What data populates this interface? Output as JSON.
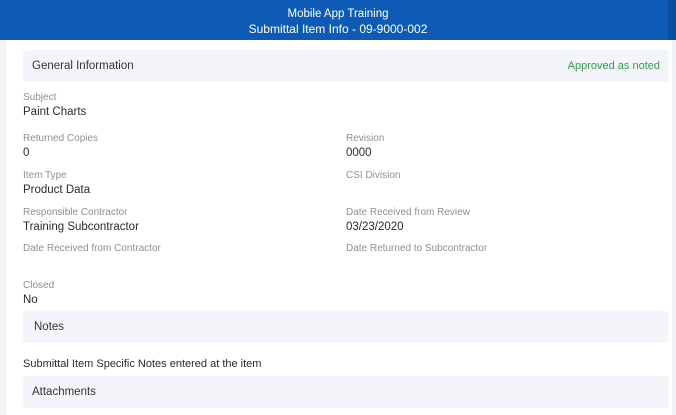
{
  "header": {
    "app_name": "Mobile App Training",
    "screen_title": "Submittal Item Info - 09-9000-002"
  },
  "general": {
    "title": "General Information",
    "status": "Approved as noted",
    "status_color": "#2e9d46"
  },
  "fields": {
    "subject": {
      "label": "Subject",
      "value": "Paint Charts"
    },
    "returned_copies": {
      "label": "Returned Copies",
      "value": "0"
    },
    "revision": {
      "label": "Revision",
      "value": "0000"
    },
    "item_type": {
      "label": "Item Type",
      "value": "Product Data"
    },
    "csi_division": {
      "label": "CSI Division",
      "value": ""
    },
    "responsible_contractor": {
      "label": "Responsible Contractor",
      "value": "Training Subcontractor"
    },
    "date_received_review": {
      "label": "Date Received from Review",
      "value": "03/23/2020"
    },
    "date_received_contractor": {
      "label": "Date Received from Contractor",
      "value": ""
    },
    "date_returned_subcontractor": {
      "label": "Date Returned to Subcontractor",
      "value": ""
    },
    "closed": {
      "label": "Closed",
      "value": "No"
    }
  },
  "notes": {
    "title": "Notes",
    "text": "Submittal Item Specific Notes entered at the item"
  },
  "attachments": {
    "title": "Attachments"
  },
  "colors": {
    "header_bg": "#0d5bb5",
    "section_bg": "#f3f5fa",
    "label": "#8c8f94"
  }
}
